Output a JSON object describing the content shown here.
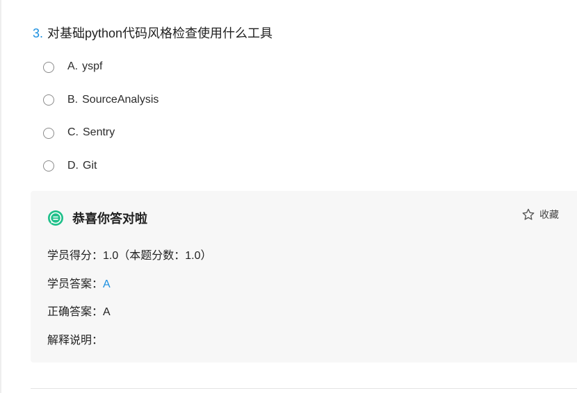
{
  "question": {
    "number": "3.",
    "text": "对基础python代码风格检查使用什么工具"
  },
  "options": [
    {
      "key": "A.",
      "text": "yspf"
    },
    {
      "key": "B.",
      "text": "SourceAnalysis"
    },
    {
      "key": "C.",
      "text": "Sentry"
    },
    {
      "key": "D.",
      "text": "Git"
    }
  ],
  "result": {
    "title": "恭喜你答对啦",
    "favorite_label": "收藏",
    "score_label": "学员得分：",
    "score_value": "1.0（本题分数：1.0）",
    "student_answer_label": "学员答案：",
    "student_answer_value": "A",
    "correct_answer_label": "正确答案：",
    "correct_answer_value": "A",
    "explanation_label": "解释说明："
  },
  "colors": {
    "accent": "#1a8fe0",
    "success_icon": "#1fc08a",
    "panel_bg": "#f7f7f7"
  }
}
